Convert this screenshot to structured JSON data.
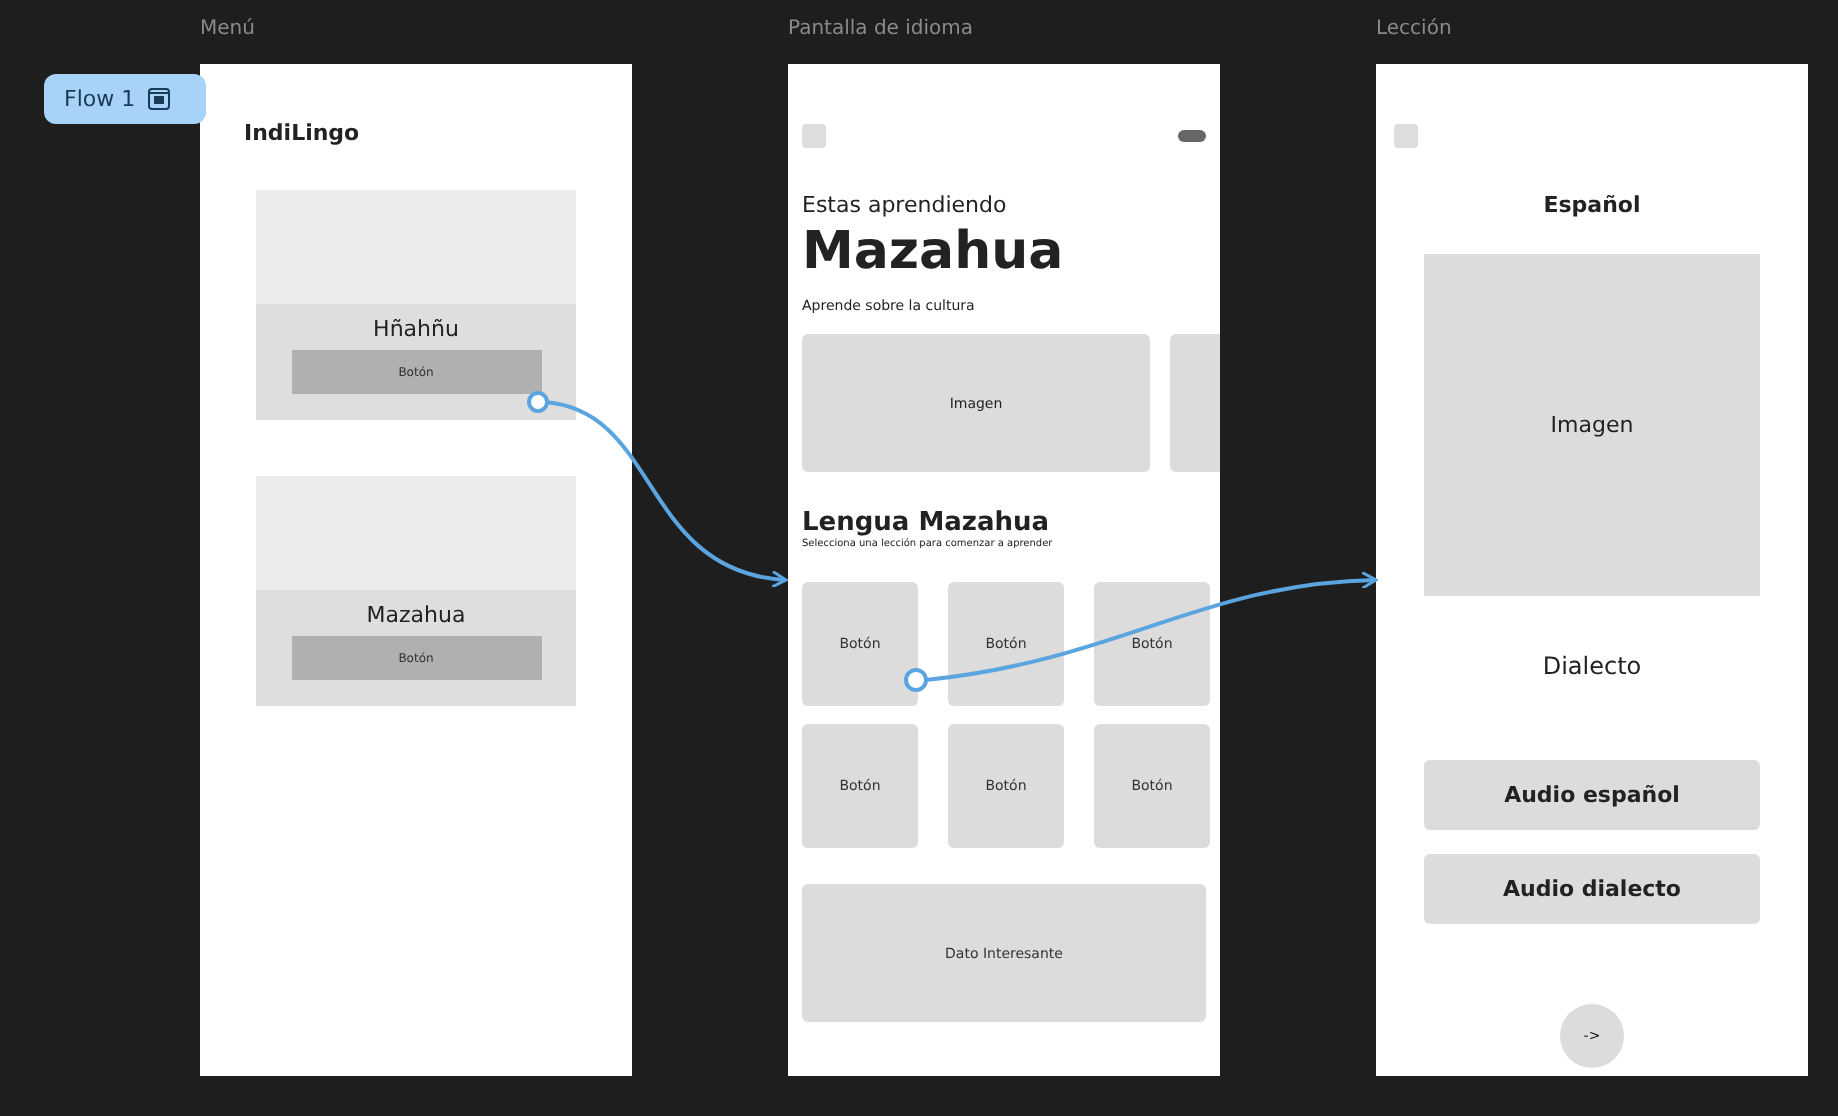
{
  "flow_badge": {
    "label": "Flow 1"
  },
  "frames": [
    {
      "kind": "menu",
      "title": "Menú",
      "app_name": "IndiLingo",
      "cards": [
        {
          "name": "Hñahñu",
          "button": "Botón"
        },
        {
          "name": "Mazahua",
          "button": "Botón"
        }
      ]
    },
    {
      "kind": "language",
      "title": "Pantalla de idioma",
      "eyebrow": "Estas aprendiendo",
      "language": "Mazahua",
      "culture_label": "Aprende sobre la cultura",
      "images": [
        "Imagen"
      ],
      "section_title": "Lengua Mazahua",
      "section_hint": "Selecciona una lección para comenzar a aprender",
      "lessons": [
        "Botón",
        "Botón",
        "Botón",
        "Botón",
        "Botón",
        "Botón"
      ],
      "fact": "Dato Interesante"
    },
    {
      "kind": "lesson",
      "title": "Lección",
      "word": "Español",
      "image": "Imagen",
      "dialect": "Dialecto",
      "audio_buttons": [
        "Audio español",
        "Audio dialecto"
      ],
      "next": "->"
    }
  ]
}
